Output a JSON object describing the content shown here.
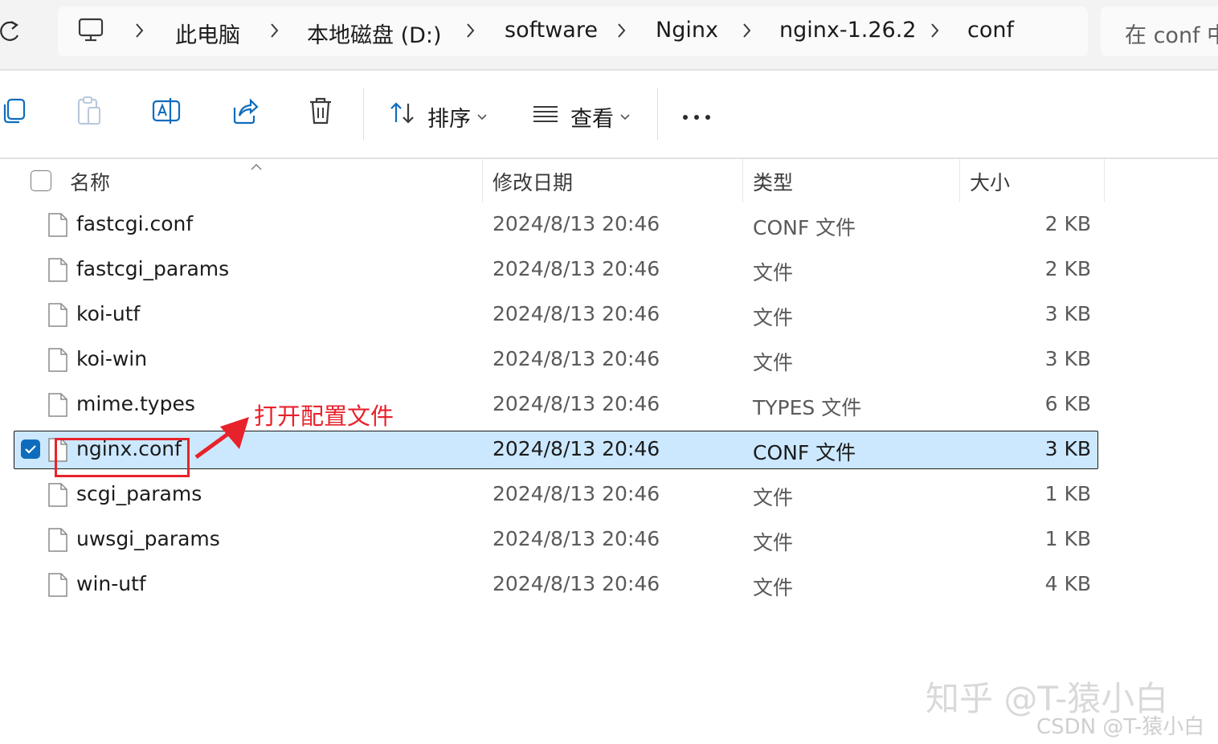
{
  "address_bar": {
    "breadcrumbs": [
      "此电脑",
      "本地磁盘 (D:)",
      "software",
      "Nginx",
      "nginx-1.26.2",
      "conf"
    ],
    "search_placeholder": "在 conf 中"
  },
  "toolbar": {
    "sort_label": "排序",
    "view_label": "查看"
  },
  "columns": {
    "name": "名称",
    "date": "修改日期",
    "type": "类型",
    "size": "大小"
  },
  "files": [
    {
      "name": "fastcgi.conf",
      "date": "2024/8/13 20:46",
      "type": "CONF 文件",
      "size": "2 KB",
      "selected": false
    },
    {
      "name": "fastcgi_params",
      "date": "2024/8/13 20:46",
      "type": "文件",
      "size": "2 KB",
      "selected": false
    },
    {
      "name": "koi-utf",
      "date": "2024/8/13 20:46",
      "type": "文件",
      "size": "3 KB",
      "selected": false
    },
    {
      "name": "koi-win",
      "date": "2024/8/13 20:46",
      "type": "文件",
      "size": "3 KB",
      "selected": false
    },
    {
      "name": "mime.types",
      "date": "2024/8/13 20:46",
      "type": "TYPES 文件",
      "size": "6 KB",
      "selected": false
    },
    {
      "name": "nginx.conf",
      "date": "2024/8/13 20:46",
      "type": "CONF 文件",
      "size": "3 KB",
      "selected": true
    },
    {
      "name": "scgi_params",
      "date": "2024/8/13 20:46",
      "type": "文件",
      "size": "1 KB",
      "selected": false
    },
    {
      "name": "uwsgi_params",
      "date": "2024/8/13 20:46",
      "type": "文件",
      "size": "1 KB",
      "selected": false
    },
    {
      "name": "win-utf",
      "date": "2024/8/13 20:46",
      "type": "文件",
      "size": "4 KB",
      "selected": false
    }
  ],
  "annotation": {
    "text": "打开配置文件",
    "color": "#e8222b"
  },
  "watermarks": {
    "zhihu": "知乎 @T-猿小白",
    "csdn": "CSDN @T-猿小白"
  },
  "colors": {
    "selection": "#cce8ff",
    "accent": "#0f6cbd"
  }
}
